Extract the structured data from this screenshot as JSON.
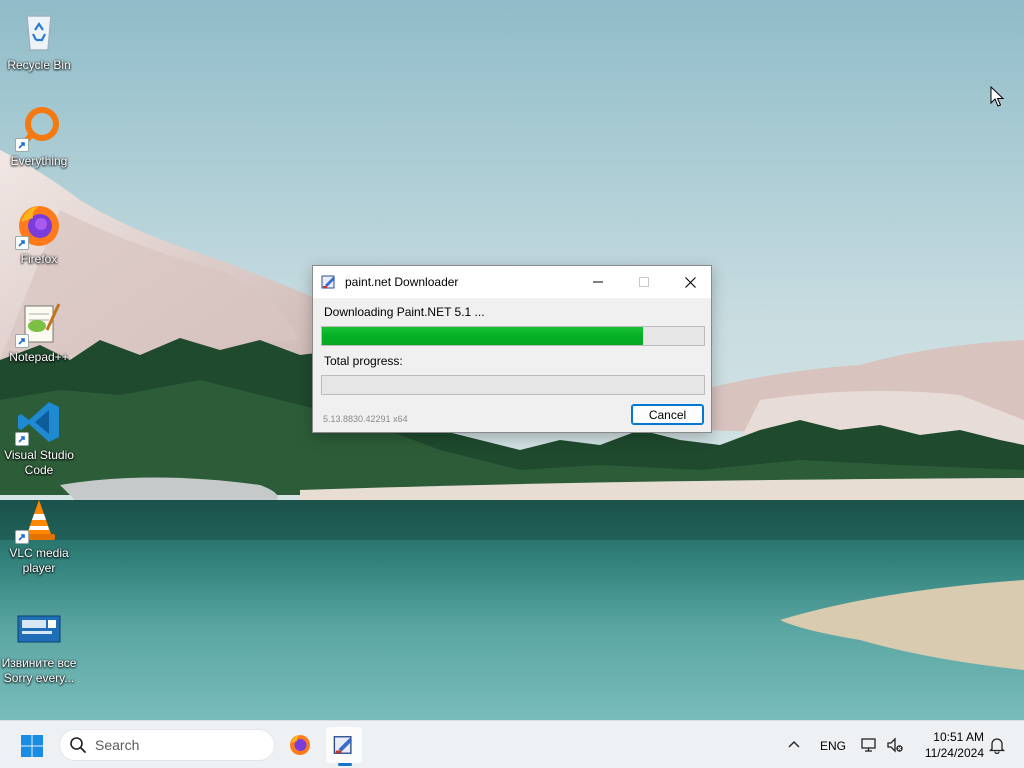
{
  "desktop": {
    "icons": [
      {
        "label": "Recycle Bin",
        "icon": "recycle-bin-icon"
      },
      {
        "label": "Everything",
        "icon": "everything-search-icon"
      },
      {
        "label": "Firefox",
        "icon": "firefox-icon"
      },
      {
        "label": "Notepad++",
        "icon": "notepadpp-icon"
      },
      {
        "label": "Visual Studio\nCode",
        "icon": "vscode-icon"
      },
      {
        "label": "VLC media\nplayer",
        "icon": "vlc-icon"
      },
      {
        "label": "Извините все\nSorry every...",
        "icon": "sorry-image-icon"
      }
    ]
  },
  "dialog": {
    "title": "paint.net Downloader",
    "status": "Downloading Paint.NET 5.1 ...",
    "download_progress": 0.84,
    "total_label": "Total progress:",
    "total_progress": 0,
    "version": "5.13.8830.42291 x64",
    "cancel_label": "Cancel",
    "progress_color": "#06b025"
  },
  "taskbar": {
    "search_placeholder": "Search",
    "language": "ENG",
    "time": "10:51 AM",
    "date": "11/24/2024",
    "apps": [
      {
        "name": "Firefox",
        "icon": "firefox-icon"
      },
      {
        "name": "paint.net Downloader",
        "icon": "paintnet-icon",
        "active": true
      }
    ]
  }
}
